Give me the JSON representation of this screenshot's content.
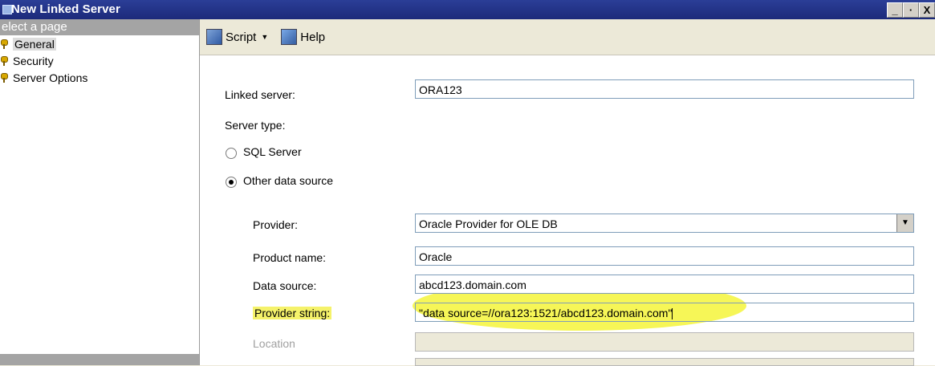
{
  "window": {
    "title": "New Linked Server",
    "controls": [
      "_",
      "·",
      "X"
    ]
  },
  "sidebar": {
    "header": "elect a page",
    "items": [
      {
        "label": "General",
        "selected": true
      },
      {
        "label": "Security",
        "selected": false
      },
      {
        "label": "Server Options",
        "selected": false
      }
    ]
  },
  "toolbar": {
    "script_label": "Script",
    "help_label": "Help"
  },
  "form": {
    "linked_server_label": "Linked server:",
    "linked_server_value": "ORA123",
    "server_type_label": "Server type:",
    "radio_sql_label": "SQL Server",
    "radio_other_label": "Other data source",
    "provider_label": "Provider:",
    "provider_value": "Oracle Provider for OLE DB",
    "product_label": "Product name:",
    "product_value": "Oracle",
    "datasource_label": "Data source:",
    "datasource_value": "abcd123.domain.com",
    "provider_string_label": "Provider string:",
    "provider_string_value": "\"data source=//ora123:1521/abcd123.domain.com\"",
    "location_label": "Location"
  },
  "colors": {
    "highlight": "#f5f26a",
    "titlebar": "#1c2a7a"
  }
}
